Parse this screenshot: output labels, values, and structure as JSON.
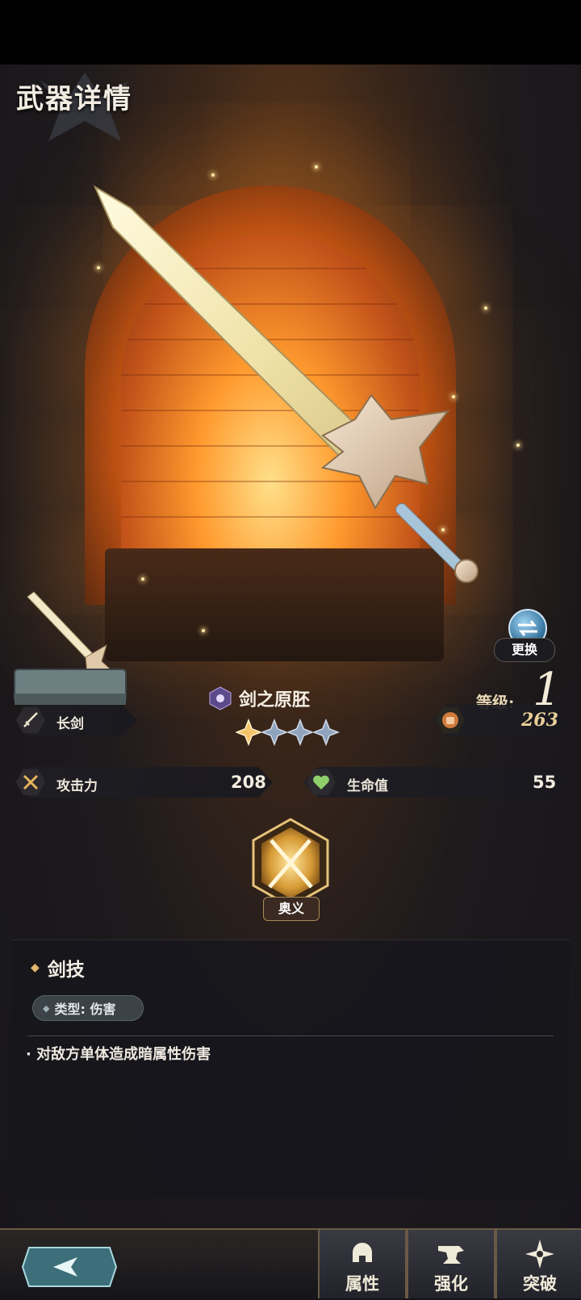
{
  "page_title": "武器详情",
  "weapon": {
    "name": "剑之原胚",
    "stars_filled": 1,
    "stars_total": 4,
    "type_label": "长剑",
    "level_label": "等级:",
    "level_value": "1",
    "exp_value": "263"
  },
  "stats": [
    {
      "label": "攻击力",
      "value": "208"
    },
    {
      "label": "生命值",
      "value": "55"
    }
  ],
  "swap_label": "更换",
  "ougi_label": "奥义",
  "skill": {
    "title": "剑技",
    "type_label": "类型: 伤害",
    "description": "· 对敌方单体造成暗属性伤害"
  },
  "tabs": [
    {
      "label": "属性",
      "icon": "helmet-icon"
    },
    {
      "label": "强化",
      "icon": "anvil-icon"
    },
    {
      "label": "突破",
      "icon": "shuriken-icon"
    }
  ],
  "colors": {
    "accent_gold": "#e1b86a",
    "exp_text": "#e8cf98",
    "panel_bg": "#16161c"
  }
}
